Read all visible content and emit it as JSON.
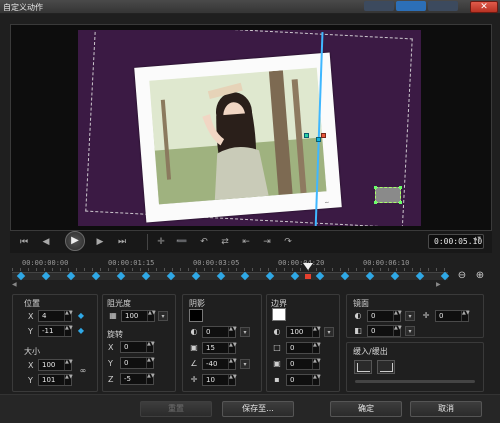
{
  "window": {
    "title": "自定义动作",
    "close_glyph": "✕"
  },
  "preview": {},
  "transport": {
    "buttons": [
      {
        "name": "go-to-start",
        "glyph": "⏮"
      },
      {
        "name": "prev-frame",
        "glyph": "◀"
      },
      {
        "name": "play",
        "glyph": "▶"
      },
      {
        "name": "next-frame",
        "glyph": "▶"
      },
      {
        "name": "go-to-end",
        "glyph": "⏭"
      }
    ],
    "timecode": "0:00:05.10",
    "timecode_spin": "▲▼"
  },
  "timeline": {
    "labels": [
      "00:00:00:00",
      "00:00:01:15",
      "00:00:03:05",
      "00:00:04:20",
      "00:00:06:10"
    ],
    "keyframe_count": 18,
    "zoom_out": "⊖",
    "zoom_in": "⊕"
  },
  "position": {
    "title": "位置",
    "x_label": "X",
    "y_label": "Y",
    "x": "4",
    "y": "-11"
  },
  "size": {
    "title": "大小",
    "x_label": "X",
    "y_label": "Y",
    "x": "100",
    "y": "101"
  },
  "opacity": {
    "title": "阻光度",
    "value": "100"
  },
  "rotation": {
    "title": "旋转",
    "x_label": "X",
    "y_label": "Y",
    "z_label": "Z",
    "x": "0",
    "y": "0",
    "z": "-5"
  },
  "shadow": {
    "title": "阴影",
    "values": [
      "0",
      "15",
      "-40",
      "10"
    ],
    "color": "#000000"
  },
  "border": {
    "title": "边界",
    "values": [
      "100",
      "0",
      "0",
      "0"
    ],
    "color": "#ffffff"
  },
  "mirror": {
    "title": "镜面",
    "values": [
      "0",
      "0",
      "0"
    ]
  },
  "ease": {
    "title": "缓入/缓出"
  },
  "footer": {
    "reset": "重置",
    "save_to": "保存至...",
    "ok": "确定",
    "cancel": "取消"
  }
}
